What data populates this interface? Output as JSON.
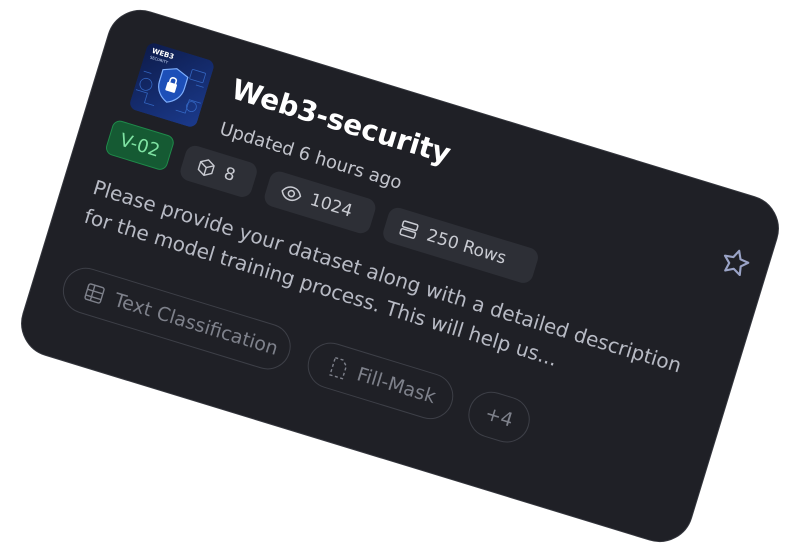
{
  "dataset": {
    "title": "Web3-security",
    "updated": "Updated 6 hours ago",
    "version": "V-02",
    "thumbnail_text": {
      "line1": "WEB3",
      "line2": "SECURITY"
    },
    "stats": {
      "downloads": "8",
      "views": "1024",
      "rows": "250 Rows"
    },
    "description": "Please provide your dataset along with a detailed description for the model training process. This will help us...",
    "tags": [
      {
        "label": "Text Classification",
        "icon": "text-classification-icon"
      },
      {
        "label": "Fill-Mask",
        "icon": "fill-mask-icon"
      }
    ],
    "more_tags": "+4",
    "favorite_icon": "star-icon"
  },
  "colors": {
    "card_bg": "#1f2026",
    "version_badge_bg": "#155a33",
    "version_badge_text": "#7fe3a3",
    "stat_bg": "#2d2f36"
  }
}
